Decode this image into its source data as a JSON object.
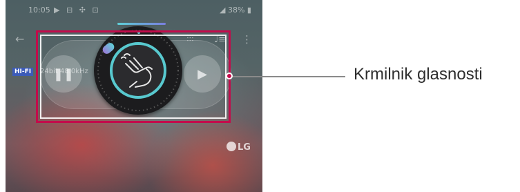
{
  "status_bar": {
    "time": "10:05",
    "icons": "▶ ⊟ ✣ ⊡",
    "battery": "38%"
  },
  "player": {
    "hifi_badge": "HI-FI",
    "format_text": "24bit 48.0kHz",
    "watermark": "LG"
  },
  "callout": {
    "label": "Krmilnik glasnosti"
  },
  "colors": {
    "highlight": "#c30b4b",
    "knob_ring": "#58c9cf"
  },
  "icons": [
    "back-arrow-icon",
    "equalizer-icon",
    "audio-settings-icon",
    "more-vert-icon",
    "pause-icon",
    "play-icon",
    "gesture-hand-icon",
    "lg-logo-icon"
  ]
}
